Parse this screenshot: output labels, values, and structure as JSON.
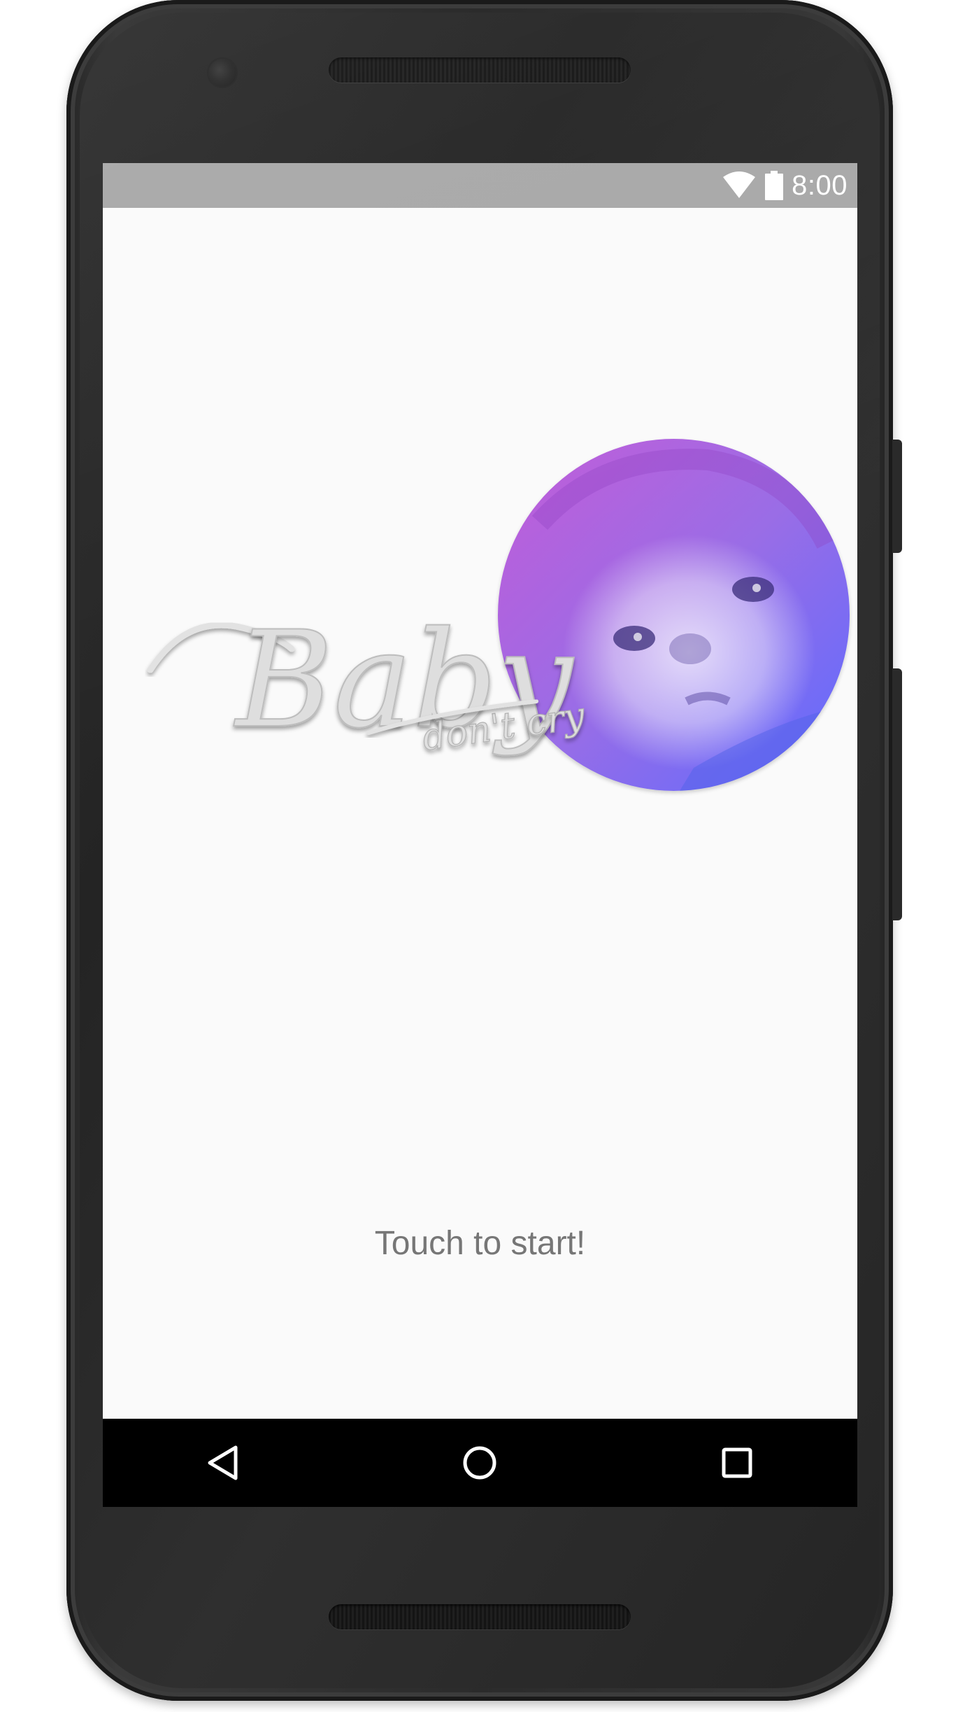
{
  "status_bar": {
    "time": "8:00",
    "icons": [
      "wifi-icon",
      "battery-icon"
    ],
    "background": "#a8a8a8"
  },
  "app": {
    "logo": {
      "title": "Baby",
      "subtitle": "don't cry"
    },
    "photo_gradient": [
      "#b34fd6",
      "#6b63ff"
    ],
    "touch_prompt": "Touch to start!",
    "background": "#fafafa"
  },
  "nav_bar": {
    "buttons": [
      "back-icon",
      "home-icon",
      "recents-icon"
    ],
    "background": "#000000"
  }
}
